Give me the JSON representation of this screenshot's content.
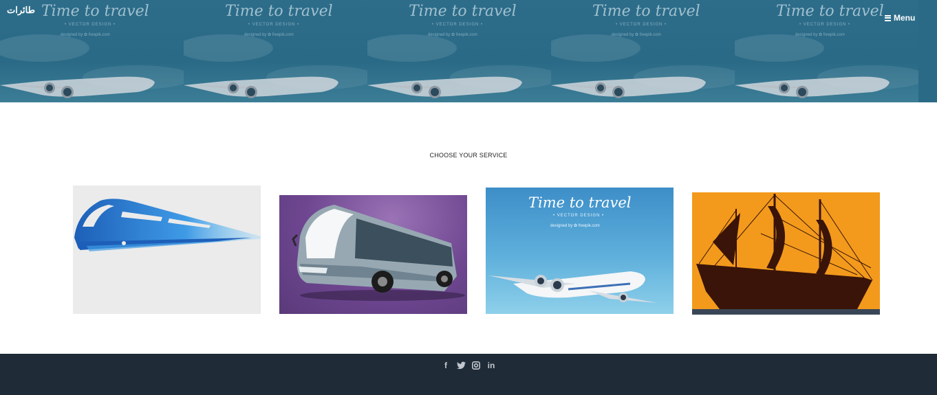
{
  "header": {
    "brand": "طائرات",
    "menu_label": "Menu",
    "banner": {
      "title": "Time to travel",
      "subtitle": "• VECTOR DESIGN •",
      "credit": "designed by ✿ freepik.com"
    }
  },
  "main": {
    "section_title": "CHOOSE YOUR SERVICE",
    "services": [
      {
        "name": "train"
      },
      {
        "name": "bus"
      },
      {
        "name": "plane",
        "title": "Time to travel",
        "subtitle": "• VECTOR DESIGN •",
        "credit": "designed by ✿ freepik.com"
      },
      {
        "name": "ship"
      }
    ]
  },
  "footer": {
    "social": [
      {
        "icon": "facebook-icon",
        "glyph": "f"
      },
      {
        "icon": "twitter-icon",
        "glyph": "🐦"
      },
      {
        "icon": "instagram-icon",
        "glyph": "◙"
      },
      {
        "icon": "linkedin-icon",
        "glyph": "in"
      }
    ]
  },
  "colors": {
    "header_bg": "#2b6a86",
    "footer_bg": "#1f2b37",
    "bus_card_bg": "#6e4690",
    "ship_card_bg": "#f39a1c",
    "train_blue": "#1f6ec2"
  }
}
